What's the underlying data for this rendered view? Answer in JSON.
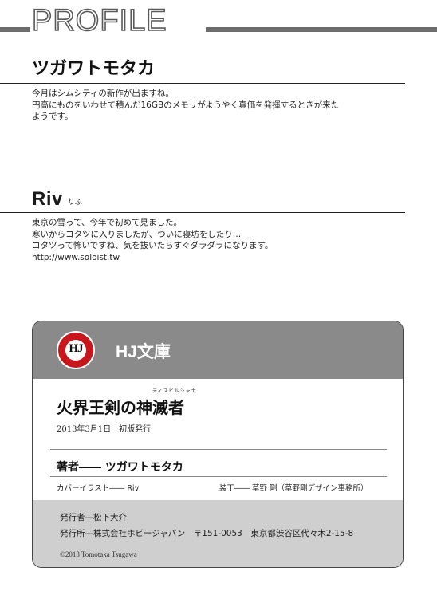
{
  "header": {
    "title": "PROFILE"
  },
  "author1": {
    "name": "ツガワトモタカ",
    "lines": [
      "今月はシムシティの新作が出ますね。",
      "円高にものをいわせて積んだ16GBのメモリがようやく真価を発揮するときが来た",
      "ようです。"
    ]
  },
  "author2": {
    "name": "Riv",
    "reading": "りふ",
    "lines": [
      "東京の雪って、今年で初めて見ました。",
      "寒いからコタツに入りましたが、ついに寝坊をしたり…",
      "コタツって怖いですね、気を抜いたらすぐダラダラになります。",
      "http://www.soloist.tw"
    ]
  },
  "colophon": {
    "logo_text": "HJ",
    "imprint": "HJ文庫",
    "title": "火界王剣の神滅者",
    "title_ruby": "ディスビルシャナ",
    "date": "2013年3月1日　初版発行",
    "author_line": "著者―― ツガワトモタカ",
    "cover_illust": "カバーイラスト―― Riv",
    "binding": "装丁―― 草野 剛（草野剛デザイン事務所）",
    "publisher_person": "発行者―松下大介",
    "publisher_company": "発行所―株式会社ホビージャパン　〒151-0053　東京都渋谷区代々木2-15-8",
    "copyright": "©2013 Tomotaka Tsugawa"
  }
}
